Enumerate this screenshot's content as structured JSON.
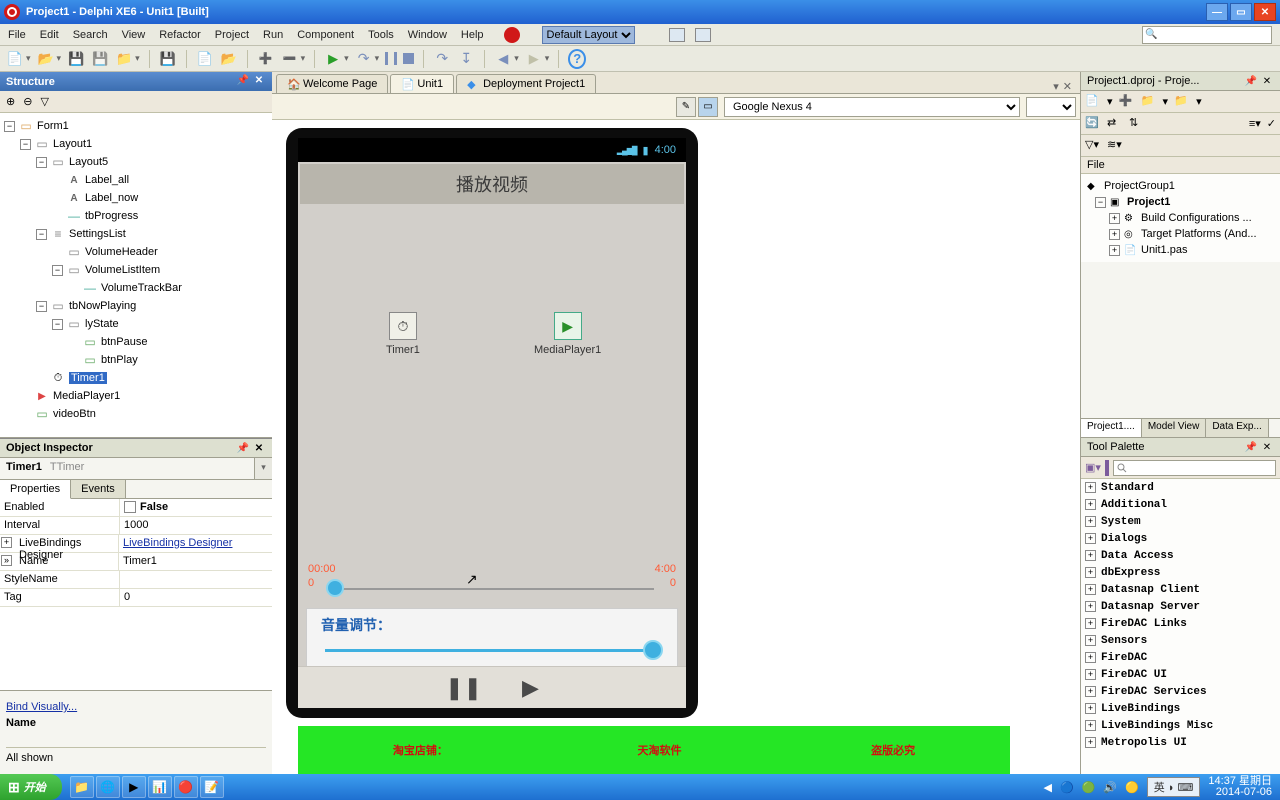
{
  "titlebar": {
    "title": "Project1 - Delphi XE6 - Unit1 [Built]"
  },
  "menu": {
    "file": "File",
    "edit": "Edit",
    "search": "Search",
    "view": "View",
    "refactor": "Refactor",
    "project": "Project",
    "run": "Run",
    "component": "Component",
    "tools": "Tools",
    "window": "Window",
    "help": "Help",
    "layout": "Default Layout"
  },
  "editorTabs": {
    "welcome": "Welcome Page",
    "unit1": "Unit1",
    "deployment": "Deployment Project1"
  },
  "deviceBar": {
    "device": "Google Nexus 4"
  },
  "structure": {
    "title": "Structure",
    "form1": "Form1",
    "layout1": "Layout1",
    "layout5": "Layout5",
    "label_all": "Label_all",
    "label_now": "Label_now",
    "tbProgress": "tbProgress",
    "settingsList": "SettingsList",
    "volumeHeader": "VolumeHeader",
    "volumeListItem": "VolumeListItem",
    "volumeTrackBar": "VolumeTrackBar",
    "tbNowPlaying": "tbNowPlaying",
    "lyState": "lyState",
    "btnPause": "btnPause",
    "btnPlay": "btnPlay",
    "timer1": "Timer1",
    "mediaPlayer1": "MediaPlayer1",
    "videoBtn": "videoBtn"
  },
  "inspector": {
    "title": "Object Inspector",
    "selName": "Timer1",
    "selType": "TTimer",
    "tabProps": "Properties",
    "tabEvents": "Events",
    "props": {
      "enabled_k": "Enabled",
      "enabled_v": "False",
      "interval_k": "Interval",
      "interval_v": "1000",
      "livebind_k": "LiveBindings Designer",
      "livebind_v": "LiveBindings Designer",
      "name_k": "Name",
      "name_v": "Timer1",
      "stylename_k": "StyleName",
      "stylename_v": "",
      "tag_k": "Tag",
      "tag_v": "0"
    },
    "bindVis": "Bind Visually...",
    "nameLbl": "Name",
    "allShown": "All shown"
  },
  "designer": {
    "time": "4:00",
    "appTitle": "播放视频",
    "timerLabel": "Timer1",
    "mediaLabel": "MediaPlayer1",
    "timeStart": "00:00",
    "timeEnd": "4:00",
    "progStart": "0",
    "progEnd": "0",
    "volumeLabel": "音量调节："
  },
  "projectPanel": {
    "title": "Project1.dproj - Proje...",
    "fileLabel": "File",
    "projectGroup": "ProjectGroup1",
    "project1": "Project1",
    "buildConfigs": "Build Configurations ...",
    "targetPlatforms": "Target Platforms (And...",
    "unit1pas": "Unit1.pas",
    "tab1": "Project1....",
    "tab2": "Model View",
    "tab3": "Data Exp..."
  },
  "palette": {
    "title": "Tool Palette",
    "cats": {
      "standard": "Standard",
      "additional": "Additional",
      "system": "System",
      "dialogs": "Dialogs",
      "dataaccess": "Data Access",
      "dbexpress": "dbExpress",
      "dsclient": "Datasnap Client",
      "dsserver": "Datasnap Server",
      "firedaclinks": "FireDAC Links",
      "sensors": "Sensors",
      "firedac": "FireDAC",
      "firedacui": "FireDAC UI",
      "firedacsvc": "FireDAC Services",
      "livebindings": "LiveBindings",
      "livebindingsmisc": "LiveBindings Misc",
      "metropolis": "Metropolis UI"
    }
  },
  "banner": {
    "a": "淘宝店铺：",
    "b": "天淘软件",
    "c": "盗版必究"
  },
  "taskbar": {
    "start": "开始",
    "lang": "英",
    "time": "14:37",
    "day": "星期日",
    "date": "2014-07-06"
  }
}
